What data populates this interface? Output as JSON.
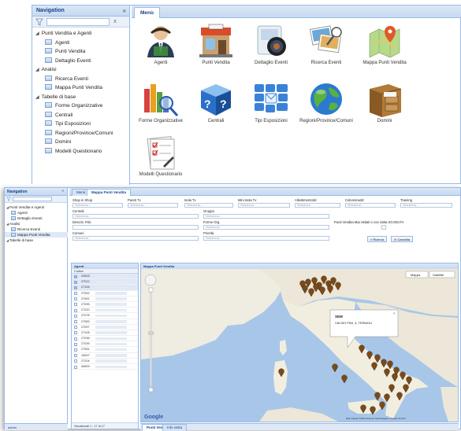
{
  "top": {
    "nav_title": "Navigation",
    "nav_collapse": "«",
    "search_clear": "x",
    "tree": [
      {
        "label": "Punti Vendita e Agenti",
        "level": 0,
        "expanded": true
      },
      {
        "label": "Agenti",
        "level": 1
      },
      {
        "label": "Punti Vendita",
        "level": 1
      },
      {
        "label": "Dettaglio Eventi",
        "level": 1
      },
      {
        "label": "Analisi",
        "level": 0,
        "expanded": true
      },
      {
        "label": "Ricerca Eventi",
        "level": 1
      },
      {
        "label": "Mappa Punti Vendita",
        "level": 1
      },
      {
        "label": "Tabelle di base",
        "level": 0,
        "expanded": true
      },
      {
        "label": "Forme Organizzative",
        "level": 1
      },
      {
        "label": "Centrali",
        "level": 1
      },
      {
        "label": "Tipi Esposizioni",
        "level": 1
      },
      {
        "label": "Regioni/Province/Comuni",
        "level": 1
      },
      {
        "label": "Domini",
        "level": 1
      },
      {
        "label": "Modelli Questionario",
        "level": 1
      }
    ],
    "tab": "Menù",
    "tiles": [
      {
        "label": "Agenti",
        "icon": "agent-icon"
      },
      {
        "label": "Punti Vendita",
        "icon": "store-icon"
      },
      {
        "label": "Dettaglio Eventi",
        "icon": "camera-icon"
      },
      {
        "label": "Ricerca Eventi",
        "icon": "photos-search-icon"
      },
      {
        "label": "Mappa Punti Vendita",
        "icon": "map-pin-icon"
      },
      {
        "label": "Forme Organizzative",
        "icon": "chart-magnifier-icon"
      },
      {
        "label": "Centrali",
        "icon": "help-box-icon"
      },
      {
        "label": "Tipi Esposizioni",
        "icon": "tiles-mail-icon"
      },
      {
        "label": "Regioni/Province/Comuni",
        "icon": "globe-icon"
      },
      {
        "label": "Domini",
        "icon": "drawer-icon"
      },
      {
        "label": "Modelli Questionario",
        "icon": "checklist-icon"
      }
    ]
  },
  "bottom": {
    "nav_title": "Navigation",
    "nav_collapse": "«",
    "tree": [
      {
        "label": "Punti Vendita e Agenti",
        "level": 0
      },
      {
        "label": "Agenti",
        "level": 1
      },
      {
        "label": "Dettaglio Eventi",
        "level": 1
      },
      {
        "label": "Analisi",
        "level": 0
      },
      {
        "label": "Ricerca Eventi",
        "level": 1
      },
      {
        "label": "Mappa Punti Vendita",
        "level": 1,
        "selected": true
      },
      {
        "label": "Tabelle di base",
        "level": 0
      }
    ],
    "nav_footer": "admin",
    "tabs": [
      "Menù",
      "Mappa Punti Vendita"
    ],
    "filters": {
      "shop_in_shop": "Shop in Shop",
      "pareti_tv": "Pareti Tv",
      "isola_tv": "Isola Tv",
      "mini_isola_tv": "Mini Isola Tv",
      "allestimento_3d": "Allestimento3d",
      "colonnina_3d": "Colonnina3d",
      "training": "Training",
      "centrali": "Centrali",
      "gruppo": "Gruppo",
      "descrizione_pdv": "Descriz. Pdv",
      "forme_org": "Forme Org.",
      "visited_label": "Punti Vendita Mai visitati o con visita SCADUTA",
      "comuni": "Comuni",
      "priorita": "Priorità",
      "placeholder": "Seleziona...",
      "search_button": "Ricerca",
      "cancel_button": "Cancella"
    },
    "agents": {
      "title": "Agenti",
      "column": "Codice",
      "codes": [
        "22603",
        "27012",
        "27126",
        "27052",
        "27061",
        "27095",
        "27220",
        "27078",
        "27083",
        "27097",
        "27108",
        "27036",
        "27039",
        "27061",
        "15097",
        "27204",
        "40809"
      ],
      "checked": [
        true,
        true,
        true,
        false,
        false,
        false,
        false,
        false,
        false,
        false,
        false,
        false,
        false,
        false,
        false,
        false,
        false
      ],
      "footer": "Visualizzati 1 - 17 di 17"
    },
    "map": {
      "title": "Mappa Punti Vendita",
      "popup_title": "SEM",
      "popup_address": "VIA DEI PINI, 3, TERMOLI",
      "google": "Google",
      "attribution": "Dati mappa ©2012 Europa Technologies, Google  Termini",
      "buttons": [
        "Mappa",
        "Satellite"
      ]
    },
    "bottom_tabs": [
      "Punti Vendita",
      "Info visita"
    ]
  },
  "colors": {
    "panel_border": "#99bbe8",
    "header_text": "#15428b",
    "header_bg": "#c7d9f0",
    "sea": "#a8c6e8",
    "land": "#f0ede4",
    "marker": "#7a4a1a"
  }
}
